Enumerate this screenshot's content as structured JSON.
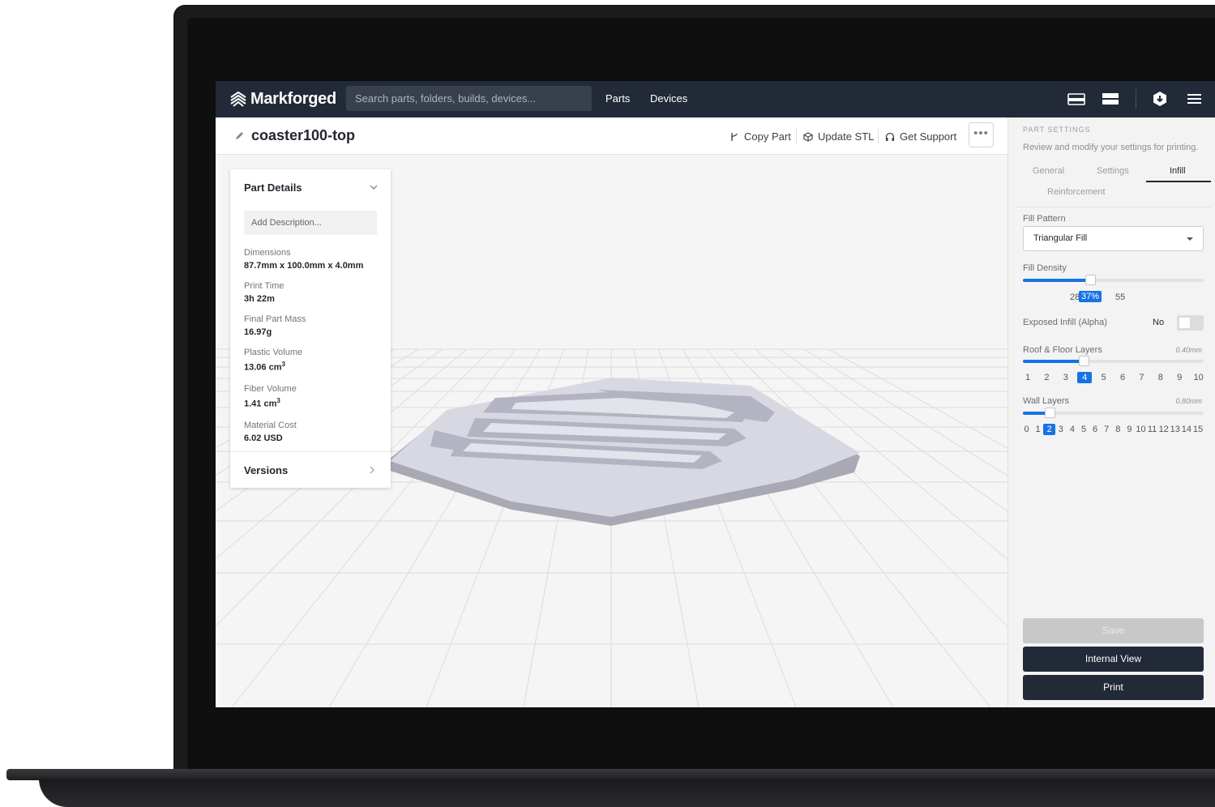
{
  "brand": {
    "name": "Markforged"
  },
  "topbar": {
    "search_placeholder": "Search parts, folders, builds, devices...",
    "nav": [
      "Parts",
      "Devices"
    ],
    "icons": [
      "printer-tray-icon",
      "printer-icon",
      "settings-hex-icon",
      "hamburger-menu-icon"
    ]
  },
  "part": {
    "name": "coaster100-top",
    "actions": {
      "copy": "Copy Part",
      "update": "Update STL",
      "support": "Get Support",
      "more": "•••"
    }
  },
  "details": {
    "title": "Part Details",
    "description_placeholder": "Add Description...",
    "rows": [
      {
        "label": "Dimensions",
        "value": "87.7mm x 100.0mm x 4.0mm"
      },
      {
        "label": "Print Time",
        "value": "3h 22m"
      },
      {
        "label": "Final Part Mass",
        "value": "16.97g"
      },
      {
        "label": "Plastic Volume",
        "value": "13.06 cm",
        "sup": "3"
      },
      {
        "label": "Fiber Volume",
        "value": "1.41 cm",
        "sup": "3"
      },
      {
        "label": "Material Cost",
        "value": "6.02 USD"
      }
    ],
    "versions": "Versions"
  },
  "settings": {
    "title": "PART SETTINGS",
    "subtitle": "Review and modify your settings for printing.",
    "tabs": [
      "General",
      "Settings",
      "Infill",
      "Reinforcement"
    ],
    "active_tab": "Infill",
    "fill_pattern": {
      "label": "Fill Pattern",
      "value": "Triangular Fill"
    },
    "fill_density": {
      "label": "Fill Density",
      "min_label": "28",
      "value": "37%",
      "max_label": "55",
      "fraction": 0.37
    },
    "exposed_infill": {
      "label": "Exposed Infill (Alpha)",
      "value": "No"
    },
    "roof_floor": {
      "label": "Roof & Floor Layers",
      "thickness": "0.40mm",
      "ticks": [
        "1",
        "2",
        "3",
        "4",
        "5",
        "6",
        "7",
        "8",
        "9",
        "10"
      ],
      "selected": "4"
    },
    "wall_layers": {
      "label": "Wall Layers",
      "thickness": "0.80mm",
      "ticks": [
        "0",
        "1",
        "2",
        "3",
        "4",
        "5",
        "6",
        "7",
        "8",
        "9",
        "10",
        "11",
        "12",
        "13",
        "14",
        "15"
      ],
      "selected": "2"
    },
    "buttons": {
      "save": "Save",
      "internal_view": "Internal View",
      "print": "Print"
    }
  },
  "colors": {
    "topbar": "#222a38",
    "accent": "#1573e6",
    "part": "#d8d8e2"
  }
}
